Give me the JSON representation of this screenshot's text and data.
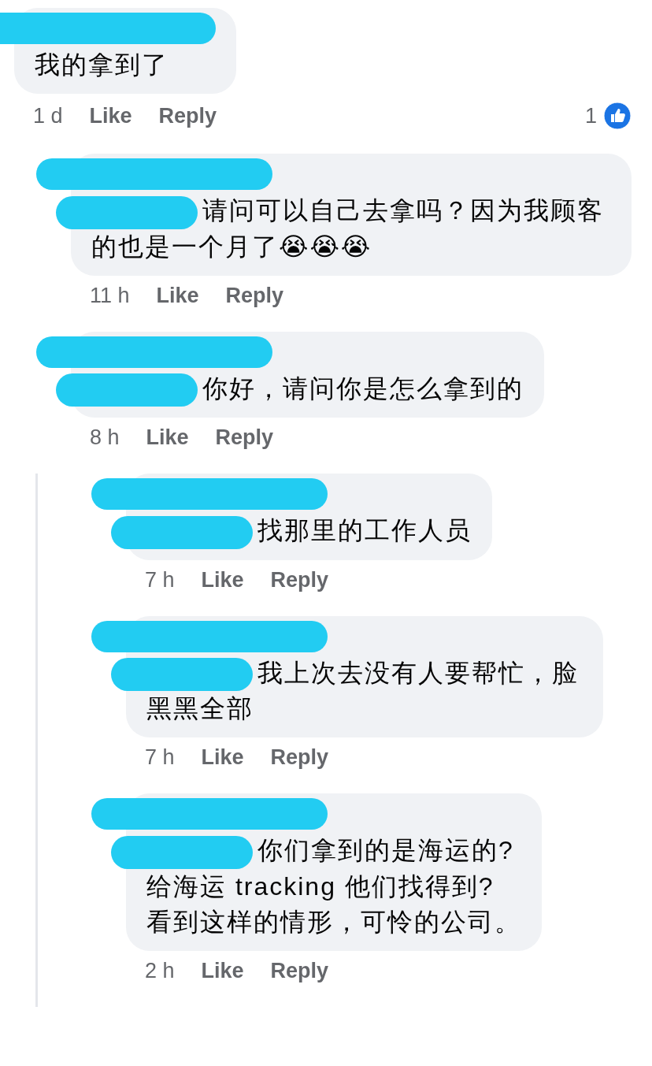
{
  "comments": [
    {
      "text": "我的拿到了",
      "mention_hidden": false,
      "time": "1 d",
      "like": "Like",
      "reply": "Reply",
      "like_count": "1",
      "children": [
        {
          "text": "请问可以自己去拿吗？因为我顾客的也是一个月了😭😭😭",
          "mention_hidden": true,
          "time": "11 h",
          "like": "Like",
          "reply": "Reply"
        },
        {
          "text": "你好，请问你是怎么拿到的",
          "mention_hidden": true,
          "time": "8 h",
          "like": "Like",
          "reply": "Reply",
          "children": [
            {
              "text": "找那里的工作人员",
              "mention_hidden": true,
              "time": "7 h",
              "like": "Like",
              "reply": "Reply"
            },
            {
              "text": "我上次去没有人要帮忙，脸黑黑全部",
              "mention_hidden": true,
              "time": "7 h",
              "like": "Like",
              "reply": "Reply"
            },
            {
              "text": "你们拿到的是海运的?\n给海运 tracking 他们找得到?\n看到这样的情形，可怜的公司。",
              "mention_hidden": true,
              "time": "2 h",
              "like": "Like",
              "reply": "Reply"
            }
          ]
        }
      ]
    }
  ]
}
